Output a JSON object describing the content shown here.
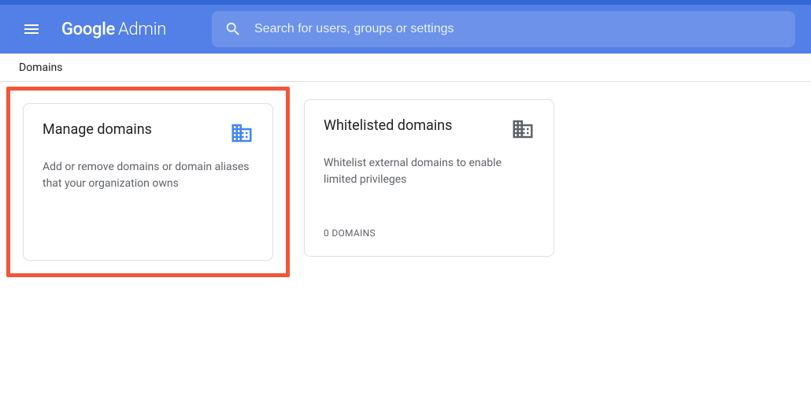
{
  "header": {
    "logo_primary": "Google",
    "logo_secondary": "Admin",
    "search_placeholder": "Search for users, groups or settings"
  },
  "subheader": {
    "title": "Domains"
  },
  "cards": {
    "manage": {
      "title": "Manage domains",
      "description": "Add or remove domains or domain aliases that your organization owns",
      "icon_color": "#4285f4"
    },
    "whitelisted": {
      "title": "Whitelisted domains",
      "description": "Whitelist external domains to enable limited privileges",
      "footer": "0 DOMAINS",
      "icon_color": "#5f6368"
    }
  }
}
